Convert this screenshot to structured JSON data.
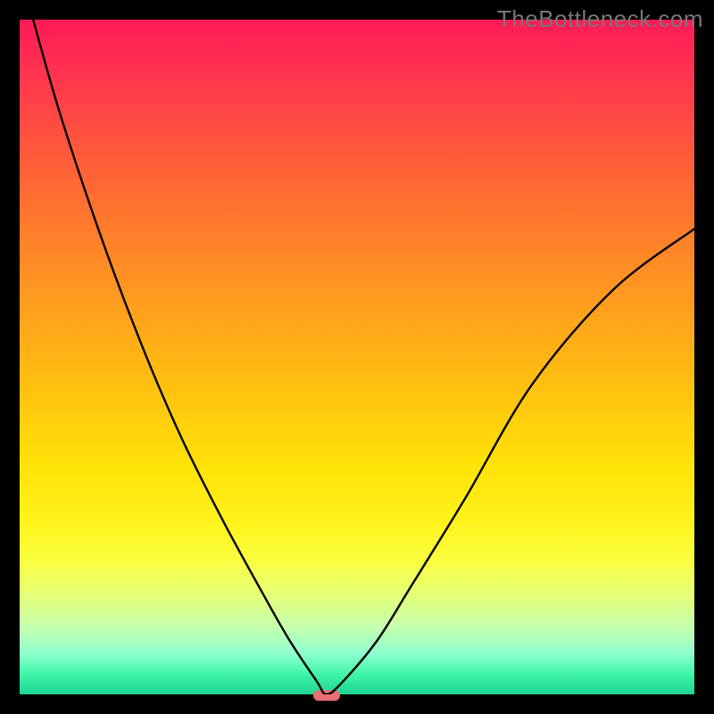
{
  "watermark": "TheBottleneck.com",
  "chart_data": {
    "type": "line",
    "title": "",
    "xlabel": "",
    "ylabel": "",
    "xlim": [
      0,
      1
    ],
    "ylim": [
      0,
      1
    ],
    "series": [
      {
        "name": "curve",
        "x": [
          0.02,
          0.06,
          0.12,
          0.18,
          0.24,
          0.3,
          0.36,
          0.4,
          0.44,
          0.455,
          0.48,
          0.53,
          0.58,
          0.66,
          0.76,
          0.88,
          1.0
        ],
        "y": [
          1.0,
          0.86,
          0.68,
          0.52,
          0.38,
          0.26,
          0.15,
          0.08,
          0.02,
          0.0,
          0.02,
          0.08,
          0.16,
          0.29,
          0.46,
          0.6,
          0.69
        ]
      }
    ],
    "marker": {
      "x": 0.455,
      "y": 0.0
    },
    "gradient_colors": {
      "top": "#ff1a56",
      "q25": "#ff7f2a",
      "mid": "#ffe208",
      "q75": "#e5ff74",
      "bottom": "#1ed494"
    }
  }
}
